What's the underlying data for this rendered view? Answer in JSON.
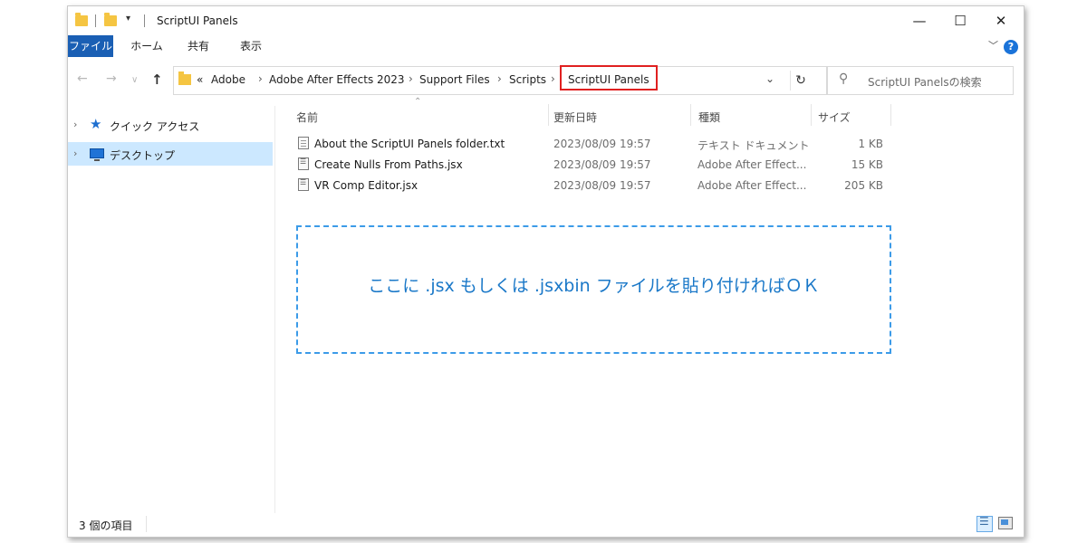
{
  "window": {
    "title": "ScriptUI Panels",
    "controls": {
      "minimize": "—",
      "maximize": "☐",
      "close": "✕"
    }
  },
  "ribbon": {
    "tabs": [
      {
        "label": "ファイル",
        "active": true
      },
      {
        "label": "ホーム"
      },
      {
        "label": "共有"
      },
      {
        "label": "表示"
      }
    ],
    "help": "?"
  },
  "address": {
    "overflow": "«",
    "crumbs": [
      "Adobe",
      "Adobe After Effects 2023",
      "Support Files",
      "Scripts"
    ],
    "current": "ScriptUI Panels",
    "highlight_color": "#e02020"
  },
  "search": {
    "placeholder": "ScriptUI Panelsの検索"
  },
  "navpane": {
    "items": [
      {
        "label": "クイック アクセス",
        "icon": "star-icon"
      },
      {
        "label": "デスクトップ",
        "icon": "desktop-icon",
        "selected": true
      }
    ]
  },
  "columns": {
    "name": "名前",
    "date": "更新日時",
    "type": "種類",
    "size": "サイズ"
  },
  "files": [
    {
      "name": "About the ScriptUI Panels folder.txt",
      "date": "2023/08/09 19:57",
      "type": "テキスト ドキュメント",
      "size": "1 KB",
      "icon": "text-file-icon"
    },
    {
      "name": "Create Nulls From Paths.jsx",
      "date": "2023/08/09 19:57",
      "type": "Adobe After Effect...",
      "size": "15 KB",
      "icon": "script-file-icon"
    },
    {
      "name": "VR Comp Editor.jsx",
      "date": "2023/08/09 19:57",
      "type": "Adobe After Effect...",
      "size": "205 KB",
      "icon": "script-file-icon"
    }
  ],
  "dropzone": {
    "text": "ここに .jsx もしくは .jsxbin ファイルを貼り付ければＯＫ",
    "color": "#1a78c8"
  },
  "status": {
    "count_text": "3 個の項目"
  },
  "accent": "#1a5fb4"
}
